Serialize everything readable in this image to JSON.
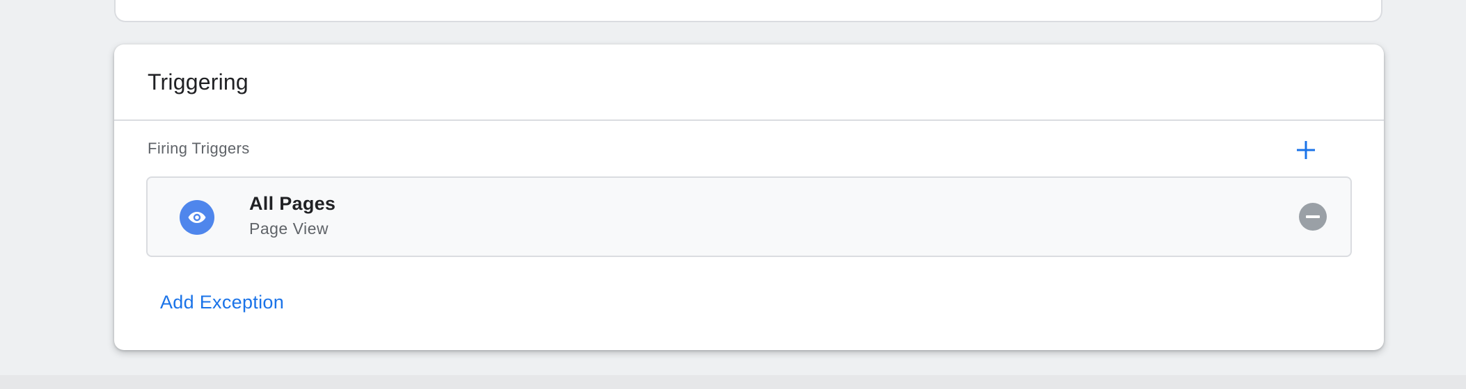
{
  "card": {
    "title": "Triggering"
  },
  "firing_triggers": {
    "label": "Firing Triggers",
    "add_icon": "plus-icon",
    "items": [
      {
        "name": "All Pages",
        "type": "Page View",
        "icon": "eye-icon",
        "remove_icon": "remove-circle-icon"
      }
    ]
  },
  "exceptions": {
    "add_label": "Add Exception"
  },
  "colors": {
    "accent": "#1a73e8",
    "trigger_icon_bg": "#4f86ec",
    "remove_icon_bg": "#9aa0a6"
  }
}
